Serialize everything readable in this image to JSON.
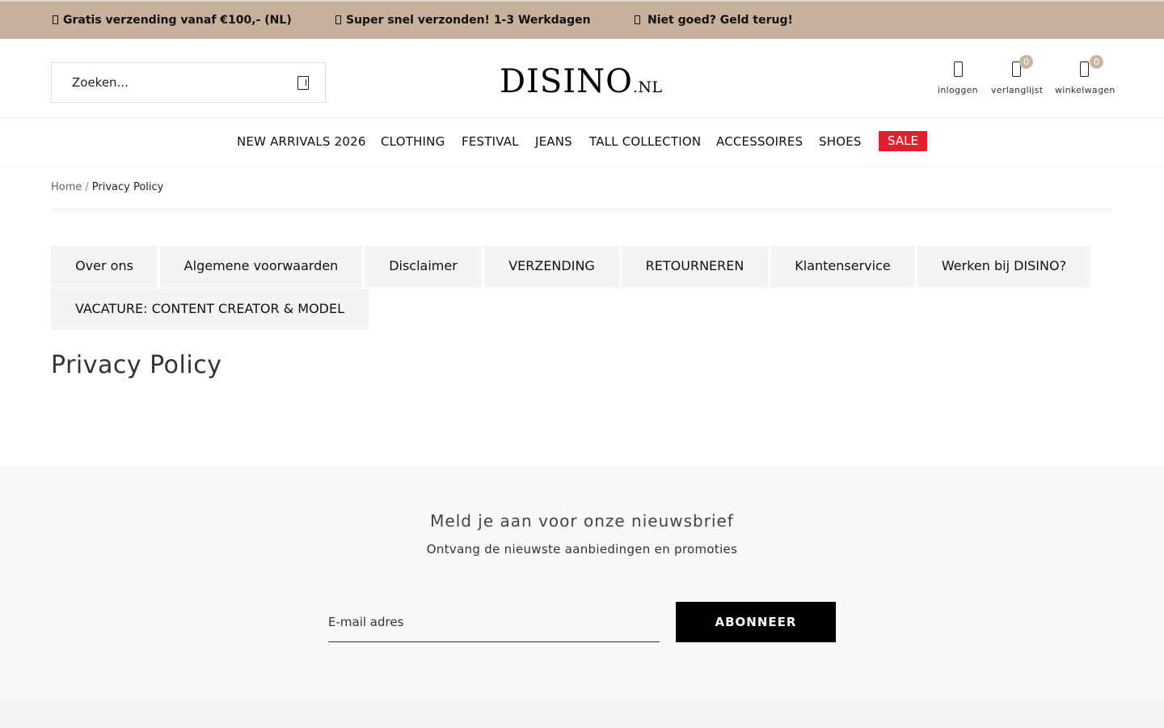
{
  "topbar": {
    "items": [
      {
        "icon": "truck-icon",
        "text": "Gratis verzending vanaf €100,- (NL)"
      },
      {
        "icon": "box-icon",
        "text": "Super snel verzonden! 1-3 Werkdagen"
      },
      {
        "icon": "return-icon",
        "text": "Niet goed? Geld terug!"
      }
    ],
    "background_color": "#c7b19c"
  },
  "header": {
    "search": {
      "placeholder": "Zoeken...",
      "icon": "search-icon"
    },
    "logo": {
      "main": "DISINO",
      "tld": ".NL"
    },
    "actions": [
      {
        "icon": "user-icon",
        "label": "inloggen"
      },
      {
        "icon": "heart-icon",
        "label": "verlanglijst",
        "count": "0"
      },
      {
        "icon": "cart-icon",
        "label": "winkelwagen",
        "count": "0"
      }
    ],
    "badge_color": "#c9b6a3"
  },
  "nav": {
    "items": [
      "NEW ARRIVALS 2026",
      "CLOTHING",
      "FESTIVAL",
      "JEANS",
      "TALL COLLECTION",
      "ACCESSOIRES",
      "SHOES"
    ],
    "sale": "SALE",
    "sale_color": "#e0202e"
  },
  "breadcrumb": {
    "home": "Home",
    "separator": "/",
    "current": "Privacy Policy"
  },
  "page_links": [
    "Over ons",
    "Algemene voorwaarden",
    "Disclaimer",
    "VERZENDING",
    "RETOURNEREN",
    "Klantenservice",
    "Werken bij DISINO?",
    "VACATURE: CONTENT CREATOR & MODEL"
  ],
  "page_title": "Privacy Policy",
  "newsletter": {
    "title": "Meld je aan voor onze nieuwsbrief",
    "subtitle": "Ontvang de nieuwste aanbiedingen en promoties",
    "email_placeholder": "E-mail adres",
    "button": "ABONNEER"
  }
}
